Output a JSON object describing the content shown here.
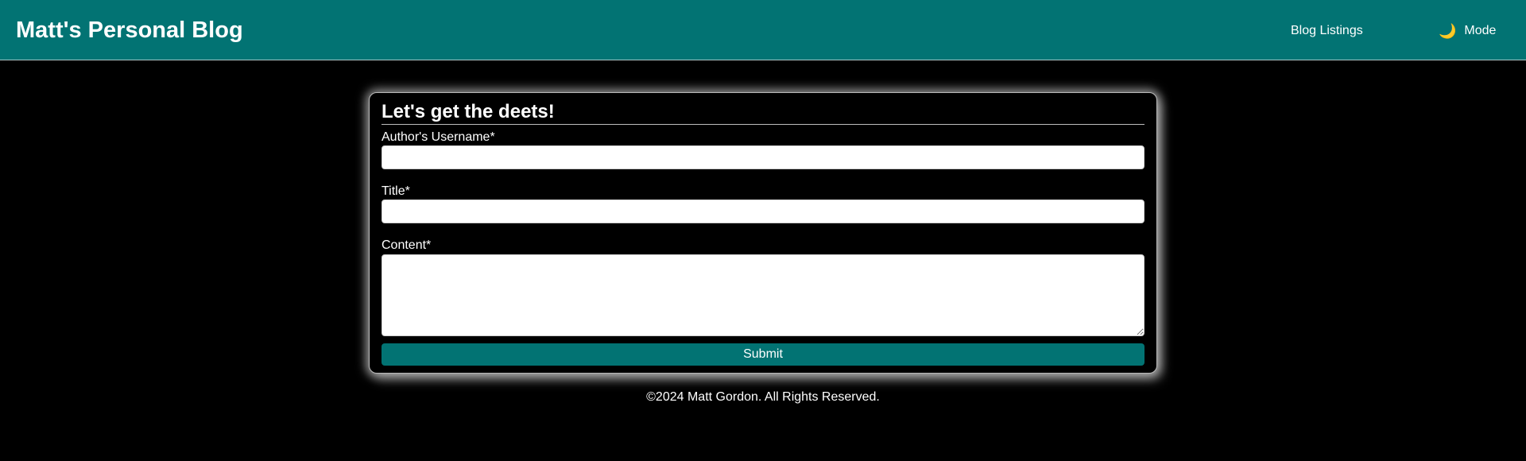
{
  "header": {
    "site_title": "Matt's Personal Blog",
    "nav_blog_listings": "Blog Listings",
    "mode_label": "Mode",
    "mode_icon": "moon-icon",
    "background_color": "#027373"
  },
  "form": {
    "title": "Let's get the deets!",
    "username_label": "Author's Username*",
    "username_value": "",
    "title_label": "Title*",
    "title_value": "",
    "content_label": "Content*",
    "content_value": "",
    "submit_label": "Submit",
    "accent_color": "#027373"
  },
  "footer": {
    "copyright": "©2024 Matt Gordon. All Rights Reserved."
  }
}
